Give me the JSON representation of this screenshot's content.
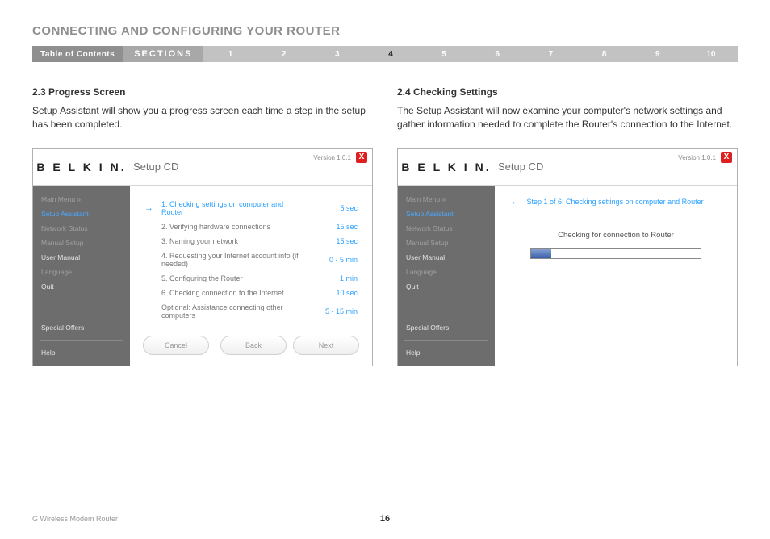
{
  "page": {
    "title": "CONNECTING AND CONFIGURING YOUR ROUTER",
    "footer_product": "G Wireless Modem Router",
    "page_number": "16"
  },
  "nav": {
    "toc_label": "Table of Contents",
    "sections_label": "SECTIONS",
    "items": [
      "1",
      "2",
      "3",
      "4",
      "5",
      "6",
      "7",
      "8",
      "9",
      "10"
    ],
    "active_index": 3
  },
  "left_section": {
    "heading": "2.3 Progress Screen",
    "text": "Setup Assistant will show you a progress screen each time a step in the setup has been completed."
  },
  "right_section": {
    "heading": "2.4 Checking Settings",
    "text": "The Setup Assistant will now examine your computer's network settings and gather information needed to complete the Router's connection to the Internet."
  },
  "common_shot": {
    "logo": "B E L K I N.",
    "setup_label": "Setup CD",
    "version_label": "Version 1.0.1",
    "close": "X",
    "sidebar": {
      "main_menu": "Main Menu  »",
      "setup_assistant": "Setup Assistant",
      "network_status": "Network Status",
      "manual_setup": "Manual Setup",
      "user_manual": "User Manual",
      "language": "Language",
      "quit": "Quit",
      "special_offers": "Special Offers",
      "help": "Help"
    }
  },
  "left_shot": {
    "steps": [
      {
        "n": "1. Checking settings on computer and Router",
        "t": "5 sec"
      },
      {
        "n": "2. Verifying hardware connections",
        "t": "15 sec"
      },
      {
        "n": "3. Naming your network",
        "t": "15 sec"
      },
      {
        "n": "4. Requesting your Internet account info (if needed)",
        "t": "0 - 5 min"
      },
      {
        "n": "5. Configuring the Router",
        "t": "1 min"
      },
      {
        "n": "6. Checking connection to the Internet",
        "t": "10 sec"
      }
    ],
    "optional": {
      "n": "Optional: Assistance connecting other computers",
      "t": "5 - 15 min"
    },
    "buttons": {
      "cancel": "Cancel",
      "back": "Back",
      "next": "Next"
    }
  },
  "right_shot": {
    "step_line": "Step 1 of 6: Checking settings on computer and Router",
    "checking_line": "Checking for connection to Router",
    "progress_percent": 12
  }
}
